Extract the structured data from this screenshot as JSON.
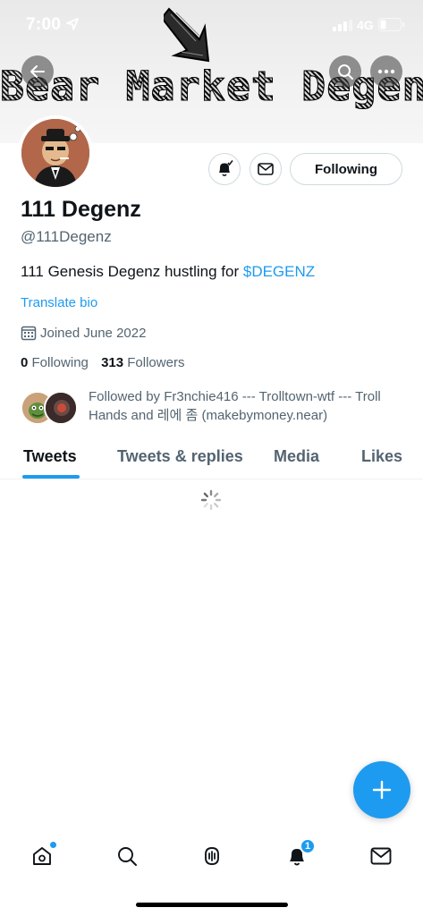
{
  "status_bar": {
    "time": "7:00",
    "network": "4G"
  },
  "banner": {
    "title": "Bear Market Degenz"
  },
  "icons": {
    "back": "arrow-left-icon",
    "search": "search-icon",
    "more": "more-icon",
    "notify": "bell-icon",
    "message": "envelope-icon",
    "calendar": "calendar-icon",
    "compose": "plus-icon"
  },
  "profile": {
    "display_name": "111 Degenz",
    "handle": "@111Degenz",
    "bio_text": "111 Genesis Degenz hustling for ",
    "bio_cashtag": "$DEGENZ",
    "translate_label": "Translate bio",
    "joined": "Joined June 2022",
    "following_count": "0",
    "following_label": "Following",
    "followers_count": "313",
    "followers_label": "Followers",
    "following_button": "Following",
    "followed_by": "Followed by Fr3nchie416 --- Trolltown-wtf --- Troll Hands and 레에 좀 (makebymoney.near)"
  },
  "tabs": [
    {
      "label": "Tweets",
      "active": true
    },
    {
      "label": "Tweets & replies",
      "active": false
    },
    {
      "label": "Media",
      "active": false
    },
    {
      "label": "Likes",
      "active": false
    }
  ],
  "bottom_nav": {
    "items": [
      "home-icon",
      "search-icon",
      "spaces-icon",
      "notifications-icon",
      "messages-icon"
    ],
    "notification_badge": "1"
  },
  "colors": {
    "accent": "#1d9bf0",
    "text_primary": "#0f1419",
    "text_secondary": "#536471"
  }
}
